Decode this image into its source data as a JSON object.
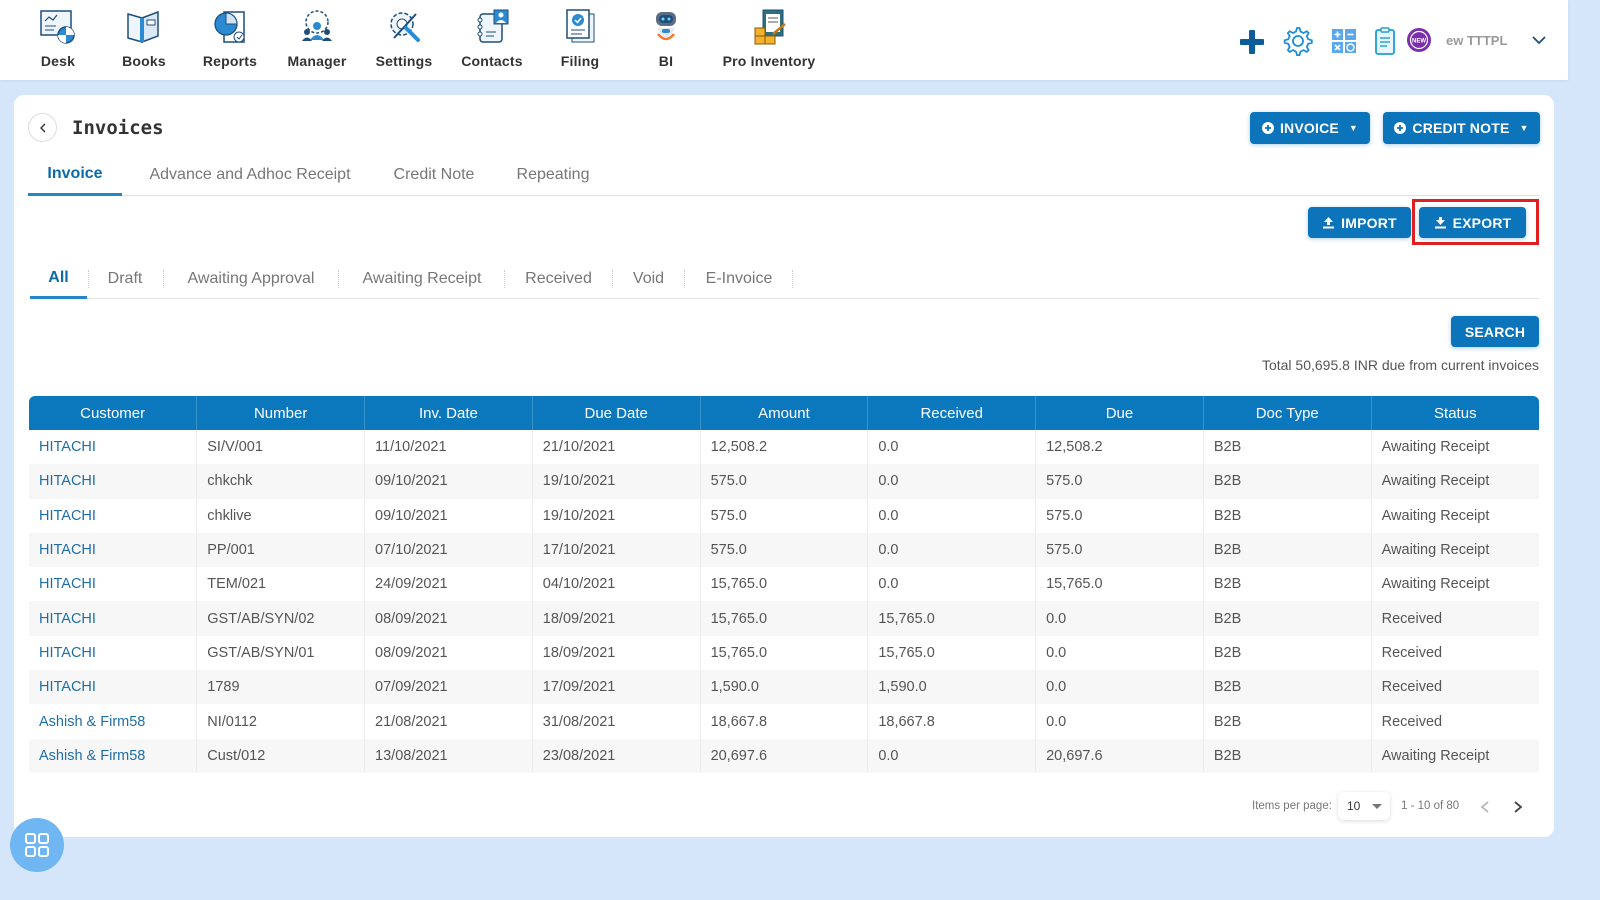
{
  "nav": {
    "items": [
      {
        "label": "Desk",
        "icon": "desk-icon"
      },
      {
        "label": "Books",
        "icon": "books-icon"
      },
      {
        "label": "Reports",
        "icon": "reports-icon"
      },
      {
        "label": "Manager",
        "icon": "manager-icon"
      },
      {
        "label": "Settings",
        "icon": "settings-tools-icon"
      },
      {
        "label": "Contacts",
        "icon": "contacts-icon"
      },
      {
        "label": "Filing",
        "icon": "filing-icon"
      },
      {
        "label": "BI",
        "icon": "robot-icon"
      },
      {
        "label": "Pro Inventory",
        "icon": "inventory-icon"
      }
    ],
    "right_icons": [
      "plus-icon",
      "gear-icon",
      "calculator-icon",
      "clipboard-icon",
      "new-badge-icon"
    ],
    "new_badge_text": "NEW",
    "org_name": "ew TTTPL"
  },
  "page": {
    "title": "Invoices",
    "buttons": {
      "invoice": "INVOICE",
      "credit_note": "CREDIT NOTE",
      "import": "IMPORT",
      "export": "EXPORT",
      "search": "SEARCH"
    },
    "tabs": [
      {
        "label": "Invoice",
        "active": true
      },
      {
        "label": "Advance and Adhoc Receipt",
        "active": false
      },
      {
        "label": "Credit Note",
        "active": false
      },
      {
        "label": "Repeating",
        "active": false
      }
    ],
    "status_tabs": [
      {
        "label": "All",
        "active": true
      },
      {
        "label": "Draft",
        "active": false
      },
      {
        "label": "Awaiting Approval",
        "active": false
      },
      {
        "label": "Awaiting Receipt",
        "active": false
      },
      {
        "label": "Received",
        "active": false
      },
      {
        "label": "Void",
        "active": false
      },
      {
        "label": "E-Invoice",
        "active": false
      }
    ],
    "total_text": "Total 50,695.8 INR due from current invoices"
  },
  "table": {
    "columns": [
      "Customer",
      "Number",
      "Inv. Date",
      "Due Date",
      "Amount",
      "Received",
      "Due",
      "Doc Type",
      "Status"
    ],
    "rows": [
      [
        "HITACHI",
        "SI/V/001",
        "11/10/2021",
        "21/10/2021",
        "12,508.2",
        "0.0",
        "12,508.2",
        "B2B",
        "Awaiting Receipt"
      ],
      [
        "HITACHI",
        "chkchk",
        "09/10/2021",
        "19/10/2021",
        "575.0",
        "0.0",
        "575.0",
        "B2B",
        "Awaiting Receipt"
      ],
      [
        "HITACHI",
        "chklive",
        "09/10/2021",
        "19/10/2021",
        "575.0",
        "0.0",
        "575.0",
        "B2B",
        "Awaiting Receipt"
      ],
      [
        "HITACHI",
        "PP/001",
        "07/10/2021",
        "17/10/2021",
        "575.0",
        "0.0",
        "575.0",
        "B2B",
        "Awaiting Receipt"
      ],
      [
        "HITACHI",
        "TEM/021",
        "24/09/2021",
        "04/10/2021",
        "15,765.0",
        "0.0",
        "15,765.0",
        "B2B",
        "Awaiting Receipt"
      ],
      [
        "HITACHI",
        "GST/AB/SYN/02",
        "08/09/2021",
        "18/09/2021",
        "15,765.0",
        "15,765.0",
        "0.0",
        "B2B",
        "Received"
      ],
      [
        "HITACHI",
        "GST/AB/SYN/01",
        "08/09/2021",
        "18/09/2021",
        "15,765.0",
        "15,765.0",
        "0.0",
        "B2B",
        "Received"
      ],
      [
        "HITACHI",
        "1789",
        "07/09/2021",
        "17/09/2021",
        "1,590.0",
        "1,590.0",
        "0.0",
        "B2B",
        "Received"
      ],
      [
        "Ashish & Firm58",
        "NI/0112",
        "21/08/2021",
        "31/08/2021",
        "18,667.8",
        "18,667.8",
        "0.0",
        "B2B",
        "Received"
      ],
      [
        "Ashish & Firm58",
        "Cust/012",
        "13/08/2021",
        "23/08/2021",
        "20,697.6",
        "0.0",
        "20,697.6",
        "B2B",
        "Awaiting Receipt"
      ]
    ]
  },
  "pagination": {
    "items_per_page_label": "Items per page:",
    "items_per_page": "10",
    "range": "1 - 10 of 80"
  },
  "colors": {
    "primary": "#0b74ba",
    "header": "#0b78bd",
    "link": "#1f6ea5",
    "highlight": "#e02020",
    "background": "#d6e6fa"
  }
}
